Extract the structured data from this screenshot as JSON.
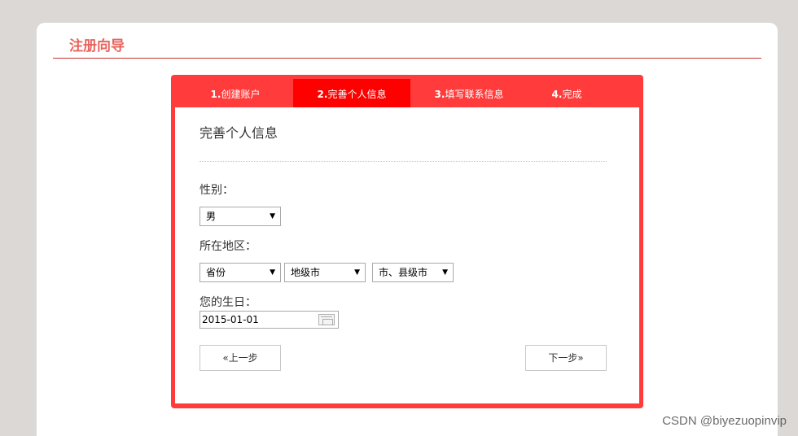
{
  "page": {
    "title": "注册向导"
  },
  "steps": [
    {
      "num": "1.",
      "label": "创建账户",
      "active": false
    },
    {
      "num": "2.",
      "label": "完善个人信息",
      "active": true
    },
    {
      "num": "3.",
      "label": "填写联系信息",
      "active": false
    },
    {
      "num": "4.",
      "label": "完成",
      "active": false
    }
  ],
  "form": {
    "section_title": "完善个人信息",
    "gender_label": "性别：",
    "gender_value": "男",
    "region_label": "所在地区：",
    "province_value": "省份",
    "city_value": "地级市",
    "county_value": "市、县级市",
    "birthday_label": "您的生日：",
    "birthday_value": "2015-01-01"
  },
  "buttons": {
    "prev": "«上一步",
    "next": "下一步»"
  },
  "dropdown_arrow": "▼",
  "watermark": "CSDN @biyezuopinvip",
  "colors": {
    "accent": "#ff3b3b",
    "active_tab": "#ff0000",
    "title": "#e8635c",
    "rule": "#c9302c"
  }
}
